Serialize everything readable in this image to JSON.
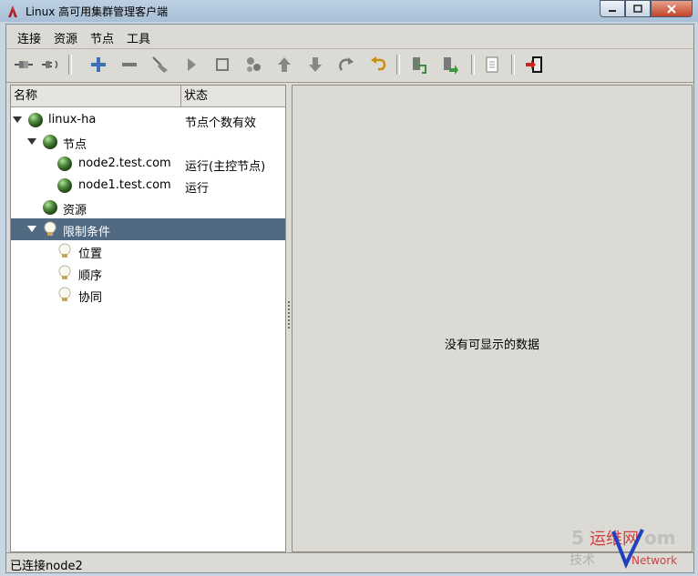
{
  "window": {
    "title": "Linux 高可用集群管理客户端"
  },
  "menubar": {
    "items": [
      "连接",
      "资源",
      "节点",
      "工具"
    ]
  },
  "toolbar": {
    "buttons": [
      "connect-icon",
      "disconnect-icon",
      "add-icon",
      "remove-icon",
      "cleanup-icon",
      "start-icon",
      "stop-icon",
      "settings-icon",
      "move-up-icon",
      "move-down-icon",
      "redo-icon",
      "undo-icon",
      "standby-node-icon",
      "active-node-icon",
      "document-icon",
      "exit-icon"
    ]
  },
  "tree": {
    "headers": {
      "name": "名称",
      "status": "状态"
    },
    "rows": [
      {
        "label": "linux-ha",
        "status": "节点个数有效",
        "icon": "green-ball-icon"
      },
      {
        "label": "节点",
        "status": "",
        "icon": "green-ball-icon"
      },
      {
        "label": "node2.test.com",
        "status": "运行(主控节点)",
        "icon": "green-ball-icon"
      },
      {
        "label": "node1.test.com",
        "status": "运行",
        "icon": "green-ball-icon"
      },
      {
        "label": "资源",
        "status": "",
        "icon": "green-ball-icon"
      },
      {
        "label": "限制条件",
        "status": "",
        "icon": "lightbulb-icon",
        "selected": true
      },
      {
        "label": "位置",
        "status": "",
        "icon": "lightbulb-icon"
      },
      {
        "label": "顺序",
        "status": "",
        "icon": "lightbulb-icon"
      },
      {
        "label": "协同",
        "status": "",
        "icon": "lightbulb-icon"
      }
    ]
  },
  "detail": {
    "empty_message": "没有可显示的数据"
  },
  "statusbar": {
    "text": "已连接node2"
  },
  "colors": {
    "selection": "#516a82",
    "panel": "#dcdad5",
    "titlebar": "#bcd0e2"
  }
}
